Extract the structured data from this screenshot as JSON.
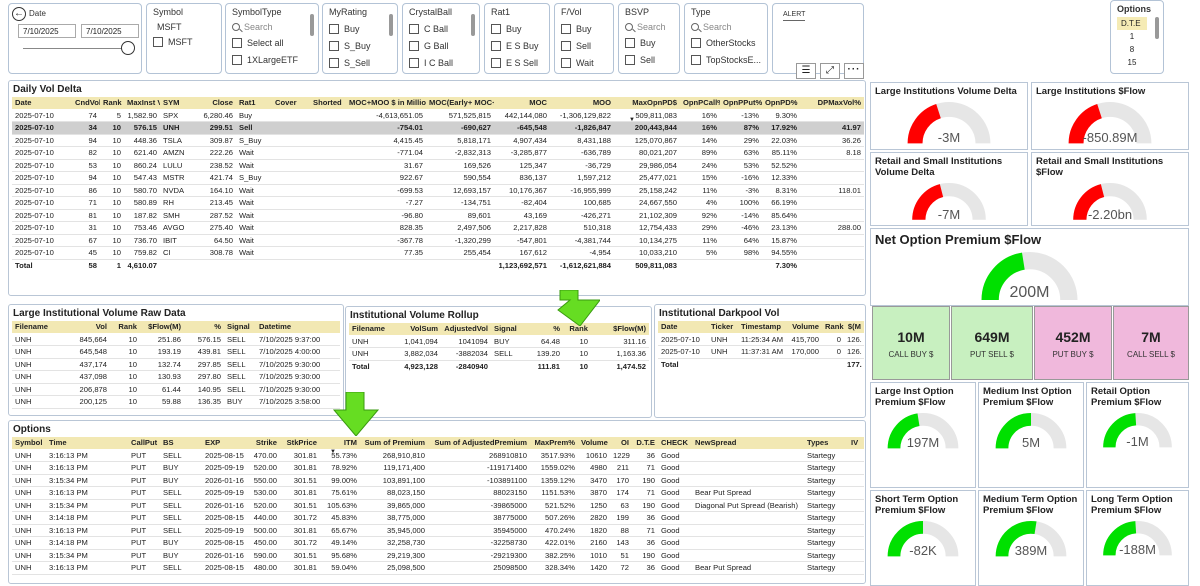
{
  "date_slicer": {
    "label": "Date",
    "start": "7/10/2025",
    "end": "7/10/2025"
  },
  "symbol_slicer": {
    "title": "Symbol",
    "value": "MSFT",
    "item": "MSFT"
  },
  "symboltype_slicer": {
    "title": "SymbolType",
    "search": "Search",
    "items": [
      "Select all",
      "1XLargeETF"
    ]
  },
  "myrating_slicer": {
    "title": "MyRating",
    "items": [
      "Buy",
      "S_Buy",
      "S_Sell"
    ]
  },
  "crystalball_slicer": {
    "title": "CrystalBall",
    "items": [
      "C Ball",
      "G Ball",
      "I C Ball"
    ]
  },
  "rat1_slicer": {
    "title": "Rat1",
    "items": [
      "Buy",
      "E S Buy",
      "E S Sell"
    ]
  },
  "fvol_slicer": {
    "title": "F/Vol",
    "items": [
      "Buy",
      "Sell",
      "Wait"
    ]
  },
  "bsvp_slicer": {
    "title": "BSVP",
    "search": "Search",
    "items": [
      "Buy",
      "Sell"
    ]
  },
  "type_slicer": {
    "title": "Type",
    "search": "Search",
    "items": [
      "OtherStocks",
      "TopStocksE..."
    ]
  },
  "alert": {
    "label": "ALERT"
  },
  "options_slicer": {
    "title": "Options",
    "selected": "D.T.E",
    "items": [
      "1",
      "8",
      "15"
    ]
  },
  "daily_vol_delta": {
    "title": "Daily Vol Delta",
    "columns": [
      "Date",
      "CndVol",
      "Rank",
      "MaxInst Vol%",
      "SYM",
      "Close",
      "Rat1",
      "Cover",
      "Shorted",
      "MOC+MOO $ in Million",
      "MOC(Early+ MOC+AH)",
      "MOC",
      "MOO",
      "MaxOpnPD$",
      "OpnPCall%",
      "OpnPPut%",
      "OpnPD%",
      "DPMaxVol%"
    ],
    "rows": [
      [
        "2025-07-10",
        "74",
        "5",
        "1,582.90",
        "SPX",
        "6,280.46",
        "Buy",
        "",
        "",
        "-4,613,651.05",
        "571,525,815",
        "442,144,080",
        "-1,306,129,822",
        "509,811,083",
        "16%",
        "-13%",
        "9.30%",
        ""
      ],
      [
        "2025-07-10",
        "34",
        "10",
        "576.15",
        "UNH",
        "299.51",
        "Sell",
        "",
        "",
        "-754.01",
        "-690,627",
        "-645,548",
        "-1,826,847",
        "200,443,844",
        "16%",
        "87%",
        "17.92%",
        "41.97"
      ],
      [
        "2025-07-10",
        "94",
        "10",
        "448.36",
        "TSLA",
        "309.87",
        "S_Buy",
        "",
        "",
        "4,415.45",
        "5,818,171",
        "4,907,434",
        "8,431,188",
        "125,070,867",
        "14%",
        "29%",
        "22.03%",
        "36.26"
      ],
      [
        "2025-07-10",
        "82",
        "10",
        "621.40",
        "AMZN",
        "222.26",
        "Wait",
        "",
        "",
        "-771.04",
        "-2,832,313",
        "-3,285,877",
        "-636,789",
        "80,021,207",
        "89%",
        "63%",
        "85.11%",
        "8.18"
      ],
      [
        "2025-07-10",
        "53",
        "10",
        "860.24",
        "LULU",
        "238.52",
        "Wait",
        "",
        "",
        "31.67",
        "169,526",
        "125,347",
        "-36,729",
        "29,986,054",
        "24%",
        "53%",
        "52.52%",
        ""
      ],
      [
        "2025-07-10",
        "94",
        "10",
        "547.43",
        "MSTR",
        "421.74",
        "S_Buy",
        "",
        "",
        "922.67",
        "590,554",
        "836,137",
        "1,597,212",
        "25,477,021",
        "15%",
        "-16%",
        "12.33%",
        ""
      ],
      [
        "2025-07-10",
        "86",
        "10",
        "580.70",
        "NVDA",
        "164.10",
        "Wait",
        "",
        "",
        "-699.53",
        "12,693,157",
        "10,176,367",
        "-16,955,999",
        "25,158,242",
        "11%",
        "-3%",
        "8.31%",
        "118.01"
      ],
      [
        "2025-07-10",
        "71",
        "10",
        "580.89",
        "RH",
        "213.45",
        "Wait",
        "",
        "",
        "-7.27",
        "-134,751",
        "-82,404",
        "100,685",
        "24,667,550",
        "4%",
        "100%",
        "66.19%",
        ""
      ],
      [
        "2025-07-10",
        "81",
        "10",
        "187.82",
        "SMH",
        "287.52",
        "Wait",
        "",
        "",
        "-96.80",
        "89,601",
        "43,169",
        "-426,271",
        "21,102,309",
        "92%",
        "-14%",
        "85.64%",
        ""
      ],
      [
        "2025-07-10",
        "31",
        "10",
        "753.46",
        "AVGO",
        "275.40",
        "Wait",
        "",
        "",
        "828.35",
        "2,497,506",
        "2,217,828",
        "510,318",
        "12,754,433",
        "29%",
        "-46%",
        "23.13%",
        "288.00"
      ],
      [
        "2025-07-10",
        "67",
        "10",
        "736.70",
        "IBIT",
        "64.50",
        "Wait",
        "",
        "",
        "-367.78",
        "-1,320,299",
        "-547,801",
        "-4,381,744",
        "10,134,275",
        "11%",
        "64%",
        "15.87%",
        ""
      ],
      [
        "2025-07-10",
        "45",
        "10",
        "759.82",
        "CI",
        "308.78",
        "Wait",
        "",
        "",
        "77.35",
        "255,454",
        "167,612",
        "-4,954",
        "10,033,210",
        "5%",
        "98%",
        "94.55%",
        ""
      ]
    ],
    "total": [
      "Total",
      "58",
      "1",
      "4,610.07",
      "",
      "",
      "",
      "",
      "",
      "",
      "",
      "1,123,692,571",
      "-1,612,621,884",
      "509,811,083",
      "",
      "",
      "7.30%",
      ""
    ]
  },
  "large_inst_raw": {
    "title": "Large Institutional Volume Raw Data",
    "columns": [
      "Filename",
      "Vol",
      "Rank",
      "$Flow(M)",
      "%",
      "Signal",
      "Datetime"
    ],
    "rows": [
      [
        "UNH",
        "845,664",
        "10",
        "251.86",
        "576.15",
        "SELL",
        "7/10/2025 9:37:00"
      ],
      [
        "UNH",
        "645,548",
        "10",
        "193.19",
        "439.81",
        "SELL",
        "7/10/2025 4:00:00"
      ],
      [
        "UNH",
        "437,174",
        "10",
        "132.74",
        "297.85",
        "SELL",
        "7/10/2025 9:30:00"
      ],
      [
        "UNH",
        "437,098",
        "10",
        "130.93",
        "297.80",
        "SELL",
        "7/10/2025 9:30:00"
      ],
      [
        "UNH",
        "206,878",
        "10",
        "61.44",
        "140.95",
        "SELL",
        "7/10/2025 9:30:00"
      ],
      [
        "UNH",
        "200,125",
        "10",
        "59.88",
        "136.35",
        "BUY",
        "7/10/2025 3:58:00"
      ]
    ]
  },
  "inst_vol_rollup": {
    "title": "Institutional Volume Rollup",
    "columns": [
      "Filename",
      "VolSum",
      "AdjustedVol",
      "Signal",
      "%",
      "Rank",
      "$Flow(M)"
    ],
    "rows": [
      [
        "UNH",
        "1,041,094",
        "1041094",
        "BUY",
        "64.48",
        "10",
        "311.16"
      ],
      [
        "UNH",
        "3,882,034",
        "-3882034",
        "SELL",
        "139.20",
        "10",
        "1,163.36"
      ]
    ],
    "total": [
      "Total",
      "4,923,128",
      "-2840940",
      "",
      "111.81",
      "10",
      "1,474.52"
    ]
  },
  "inst_darkpool": {
    "title": "Institutional Darkpool Vol",
    "columns": [
      "Date",
      "Ticker",
      "Timestamp",
      "Volume",
      "Rank",
      "$(M"
    ],
    "rows": [
      [
        "2025-07-10",
        "UNH",
        "11:25:34 AM",
        "415,700",
        "0",
        "126."
      ],
      [
        "2025-07-10",
        "UNH",
        "11:37:31 AM",
        "170,000",
        "0",
        "126."
      ]
    ],
    "total": [
      "Total",
      "",
      "",
      "",
      "",
      "177."
    ]
  },
  "options_table": {
    "title": "Options",
    "columns": [
      "Symbol",
      "Time",
      "CallPut",
      "BS",
      "EXP",
      "Strike",
      "StkPrice",
      "ITM",
      "Sum of Premium",
      "Sum of AdjustedPremium",
      "MaxPrem%",
      "Volume",
      "OI",
      "D.T.E",
      "CHECK",
      "NewSpread",
      "Types",
      "IV"
    ],
    "rows": [
      [
        "UNH",
        "3:16:13 PM",
        "PUT",
        "SELL",
        "2025-08-15",
        "470.00",
        "301.81",
        "55.73%",
        "268,910,810",
        "268910810",
        "3517.93%",
        "10610",
        "1229",
        "36",
        "Good",
        "",
        "Startegy",
        ""
      ],
      [
        "UNH",
        "3:16:13 PM",
        "PUT",
        "BUY",
        "2025-09-19",
        "520.00",
        "301.81",
        "78.92%",
        "119,171,400",
        "-119171400",
        "1559.02%",
        "4980",
        "211",
        "71",
        "Good",
        "",
        "Startegy",
        ""
      ],
      [
        "UNH",
        "3:15:34 PM",
        "PUT",
        "BUY",
        "2026-01-16",
        "550.00",
        "301.51",
        "99.00%",
        "103,891,100",
        "-103891100",
        "1359.12%",
        "3470",
        "170",
        "190",
        "Good",
        "",
        "Startegy",
        ""
      ],
      [
        "UNH",
        "3:16:13 PM",
        "PUT",
        "SELL",
        "2025-09-19",
        "530.00",
        "301.81",
        "75.61%",
        "88,023,150",
        "88023150",
        "1151.53%",
        "3870",
        "174",
        "71",
        "Good",
        "Bear Put Spread",
        "Startegy",
        ""
      ],
      [
        "UNH",
        "3:15:34 PM",
        "PUT",
        "SELL",
        "2026-01-16",
        "520.00",
        "301.51",
        "105.63%",
        "39,865,000",
        "-39865000",
        "521.52%",
        "1250",
        "63",
        "190",
        "Good",
        "Diagonal Put Spread (Bearish)",
        "Startegy",
        ""
      ],
      [
        "UNH",
        "3:14:18 PM",
        "PUT",
        "SELL",
        "2025-08-15",
        "440.00",
        "301.72",
        "45.83%",
        "38,775,000",
        "38775000",
        "507.26%",
        "2820",
        "199",
        "36",
        "Good",
        "",
        "Startegy",
        ""
      ],
      [
        "UNH",
        "3:16:13 PM",
        "PUT",
        "SELL",
        "2025-09-19",
        "500.00",
        "301.81",
        "65.67%",
        "35,945,000",
        "35945000",
        "470.24%",
        "1820",
        "88",
        "71",
        "Good",
        "",
        "Startegy",
        ""
      ],
      [
        "UNH",
        "3:14:18 PM",
        "PUT",
        "BUY",
        "2025-08-15",
        "450.00",
        "301.72",
        "49.14%",
        "32,258,730",
        "-32258730",
        "422.01%",
        "2160",
        "143",
        "36",
        "Good",
        "",
        "Startegy",
        ""
      ],
      [
        "UNH",
        "3:15:34 PM",
        "PUT",
        "BUY",
        "2026-01-16",
        "590.00",
        "301.51",
        "95.68%",
        "29,219,300",
        "-29219300",
        "382.25%",
        "1010",
        "51",
        "190",
        "Good",
        "",
        "Startegy",
        ""
      ],
      [
        "UNH",
        "3:16:13 PM",
        "PUT",
        "SELL",
        "2025-08-15",
        "480.00",
        "301.81",
        "59.04%",
        "25,098,500",
        "25098500",
        "328.34%",
        "1420",
        "72",
        "36",
        "Good",
        "Bear Put Spread",
        "Startegy",
        ""
      ]
    ]
  },
  "gauges": {
    "large_inst_vol_delta": {
      "title": "Large Institutions Volume Delta",
      "value": "-3M",
      "fraction": 0.4,
      "color": "#ff0000"
    },
    "large_inst_flow": {
      "title": "Large Institutions $Flow",
      "value": "-850.89M",
      "fraction": 0.4,
      "color": "#ff0000"
    },
    "retail_small_vol_delta": {
      "title": "Retail and Small Institutions Volume Delta",
      "value": "-7M",
      "fraction": 0.42,
      "color": "#ff0000"
    },
    "retail_small_flow": {
      "title": "Retail and Small Institutions $Flow",
      "value": "-2.20bn",
      "fraction": 0.42,
      "color": "#ff0000"
    },
    "net_option_premium": {
      "title": "Net Option Premium $Flow",
      "value": "200M",
      "fraction": 0.45,
      "color": "#00e000"
    },
    "large_inst_option": {
      "title": "Large Inst Option Premium $Flow",
      "value": "197M",
      "fraction": 0.45,
      "color": "#00e000"
    },
    "medium_inst_option": {
      "title": "Medium Inst Option Premium $Flow",
      "value": "5M",
      "fraction": 0.5,
      "color": "#00e000"
    },
    "retail_option": {
      "title": "Retail Option Premium $Flow",
      "value": "-1M",
      "fraction": 0.48,
      "color": "#00e000"
    },
    "short_term_option": {
      "title": "Short Term Option Premium $Flow",
      "value": "-82K",
      "fraction": 0.5,
      "color": "#00e000"
    },
    "medium_term_option": {
      "title": "Medium Term Option Premium $Flow",
      "value": "389M",
      "fraction": 0.55,
      "color": "#00e000"
    },
    "long_term_option": {
      "title": "Long Term Option Premium $Flow",
      "value": "-188M",
      "fraction": 0.48,
      "color": "#00e000"
    }
  },
  "tiles": [
    {
      "value": "10M",
      "label": "CALL BUY $",
      "color": "#c8f0c0"
    },
    {
      "value": "649M",
      "label": "PUT SELL $",
      "color": "#c8f0c0"
    },
    {
      "value": "452M",
      "label": "PUT BUY $",
      "color": "#f0b8dc"
    },
    {
      "value": "7M",
      "label": "CALL SELL $",
      "color": "#f0b8dc"
    }
  ],
  "colors": {
    "header": "#f2e8b3",
    "border": "#b9c6d6",
    "arrow": "#66dd22"
  }
}
